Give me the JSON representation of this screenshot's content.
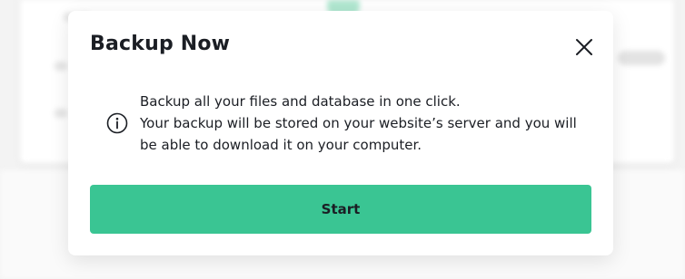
{
  "modal": {
    "title": "Backup Now",
    "info_lines": [
      "Backup all your files and database in one click.",
      "Your backup will be stored on your website’s server and you will",
      "be able to download it on your computer."
    ],
    "start_label": "Start"
  },
  "icons": {
    "close": "close-icon",
    "info": "info-icon"
  },
  "colors": {
    "accent": "#3ac593",
    "text": "#1b1e24"
  }
}
